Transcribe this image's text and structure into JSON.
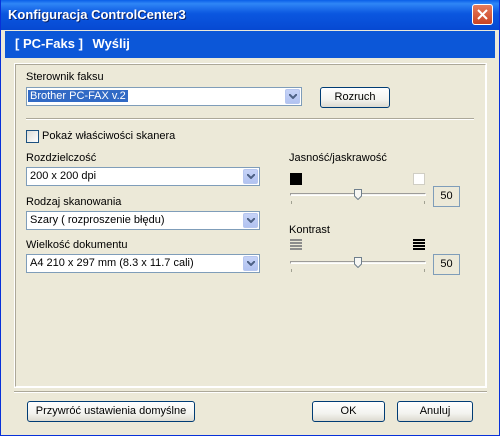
{
  "window": {
    "title": "Konfiguracja ControlCenter3"
  },
  "header": {
    "tab1": "[ PC-Faks ]",
    "tab2": "Wyślij"
  },
  "fax_driver": {
    "label": "Sterownik faksu",
    "value": "Brother PC-FAX v.2",
    "setup_button": "Rozruch"
  },
  "scanner": {
    "show_properties_label": "Pokaż właściwości skanera",
    "show_properties_checked": false,
    "resolution": {
      "label": "Rozdzielczość",
      "value": "200 x 200 dpi"
    },
    "scan_type": {
      "label": "Rodzaj skanowania",
      "value": "Szary ( rozproszenie błędu)"
    },
    "doc_size": {
      "label": "Wielkość dokumentu",
      "value": "A4 210 x 297 mm (8.3 x 11.7 cali)"
    },
    "brightness": {
      "label": "Jasność/jaskrawość",
      "value": "50",
      "level": 0.5
    },
    "contrast": {
      "label": "Kontrast",
      "value": "50",
      "level": 0.5
    }
  },
  "footer": {
    "restore_defaults": "Przywróć ustawienia domyślne",
    "ok": "OK",
    "cancel": "Anuluj"
  }
}
